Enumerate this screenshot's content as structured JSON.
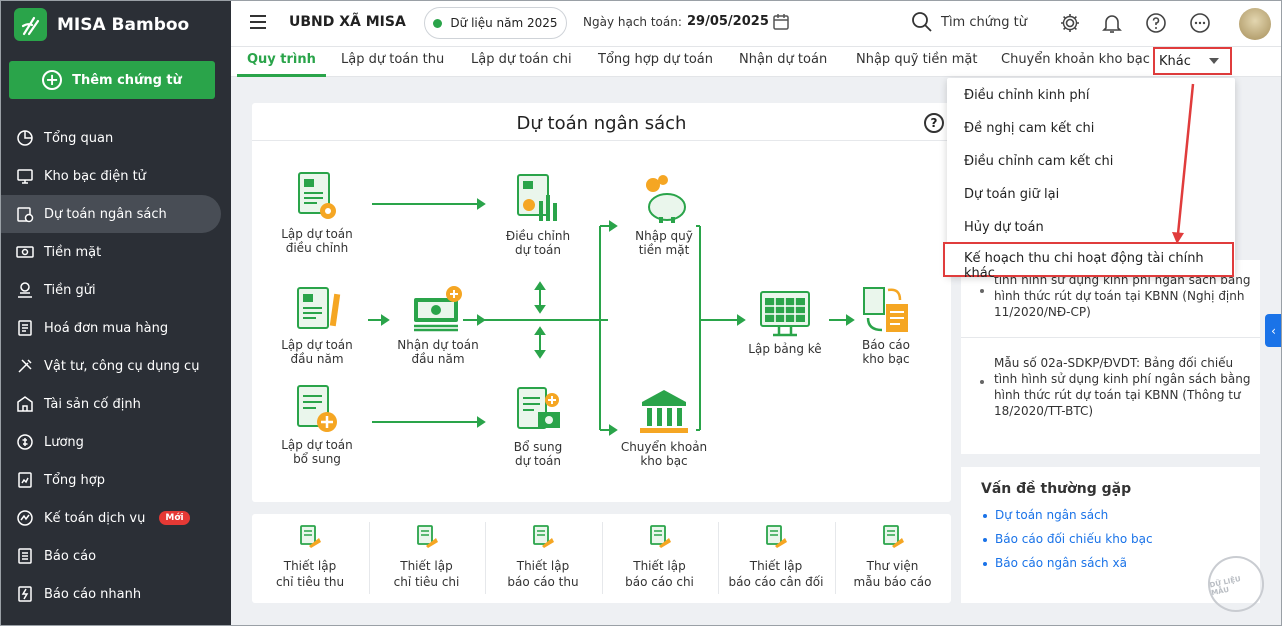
{
  "app": {
    "name": "MISA Bamboo"
  },
  "sidebar": {
    "add_button": "Thêm chứng từ",
    "items": [
      {
        "label": "Tổng quan",
        "icon": "chart-pie-icon"
      },
      {
        "label": "Kho bạc điện tử",
        "icon": "monitor-icon"
      },
      {
        "label": "Dự toán ngân sách",
        "icon": "budget-icon",
        "active": true
      },
      {
        "label": "Tiền mặt",
        "icon": "cash-icon"
      },
      {
        "label": "Tiền gửi",
        "icon": "deposit-icon"
      },
      {
        "label": "Hoá đơn mua hàng",
        "icon": "invoice-icon"
      },
      {
        "label": "Vật tư, công cụ dụng cụ",
        "icon": "tools-icon"
      },
      {
        "label": "Tài sản cố định",
        "icon": "building-icon"
      },
      {
        "label": "Lương",
        "icon": "salary-icon"
      },
      {
        "label": "Tổng hợp",
        "icon": "summary-icon"
      },
      {
        "label": "Kế toán dịch vụ",
        "icon": "service-icon",
        "badge": "Mới"
      },
      {
        "label": "Báo cáo",
        "icon": "report-icon"
      },
      {
        "label": "Báo cáo nhanh",
        "icon": "quick-report-icon"
      }
    ]
  },
  "header": {
    "org": "UBND XÃ MISA",
    "year": "Dữ liệu năm 2025",
    "date_label": "Ngày hạch toán:",
    "date_value": "29/05/2025",
    "search": "Tìm chứng từ"
  },
  "tabs": [
    "Quy trình",
    "Lập dự toán thu",
    "Lập dự toán chi",
    "Tổng hợp dự toán",
    "Nhận dự toán",
    "Nhập quỹ tiền mặt",
    "Chuyển khoản kho bạc",
    "Khác"
  ],
  "dropdown": [
    "Điều chỉnh kinh phí",
    "Đề nghị cam kết chi",
    "Điều chỉnh cam kết chi",
    "Dự toán giữ lại",
    "Hủy dự toán",
    "Kế hoạch thu chi hoạt động tài chính khác"
  ],
  "flow": {
    "title": "Dự toán ngân sách",
    "nodes": {
      "adjust_budget": [
        "Lập dự toán",
        "điều chỉnh"
      ],
      "adjust": [
        "Điều chỉnh",
        "dự toán"
      ],
      "cash_in": [
        "Nhập quỹ",
        "tiền mặt"
      ],
      "annual": [
        "Lập dự toán",
        "đầu năm"
      ],
      "receive": [
        "Nhận dự toán",
        "đầu năm"
      ],
      "statement": [
        "Lập bảng kê"
      ],
      "treasury_report": [
        "Báo cáo",
        "kho bạc"
      ],
      "supplement_budget": [
        "Lập dự toán",
        "bổ sung"
      ],
      "supplement": [
        "Bổ sung",
        "dự toán"
      ],
      "transfer": [
        "Chuyển khoản",
        "kho bạc"
      ]
    }
  },
  "shortcuts": [
    [
      "Thiết lập",
      "chỉ tiêu thu"
    ],
    [
      "Thiết lập",
      "chỉ tiêu chi"
    ],
    [
      "Thiết lập",
      "báo cáo thu"
    ],
    [
      "Thiết lập",
      "báo cáo chi"
    ],
    [
      "Thiết lập",
      "báo cáo cân đối"
    ],
    [
      "Thư viện",
      "mẫu báo cáo"
    ]
  ],
  "reports": {
    "item1": [
      "tình hình sử dụng kinh phí ngân sách bằng",
      "hình thức rút dự toán tại KBNN (Nghị định",
      "11/2020/NĐ-CP)"
    ],
    "item2": [
      "Mẫu số 02a-SDKP/ĐVDT: Bảng đối chiếu",
      "tình hình sử dụng kinh phí ngân sách bằng",
      "hình thức rút dự toán tại KBNN (Thông tư",
      "18/2020/TT-BTC)"
    ]
  },
  "faq": {
    "title": "Vấn đề thường gặp",
    "links": [
      "Dự toán ngân sách",
      "Báo cáo đối chiếu kho bạc",
      "Báo cáo ngân sách xã"
    ]
  },
  "watermark": "DỮ LIỆU MẪU",
  "colors": {
    "accent": "#2aa44a",
    "highlight": "#e03c3c",
    "sidebar": "#2b2f36",
    "link": "#1a73e8",
    "orange": "#f5a623"
  }
}
